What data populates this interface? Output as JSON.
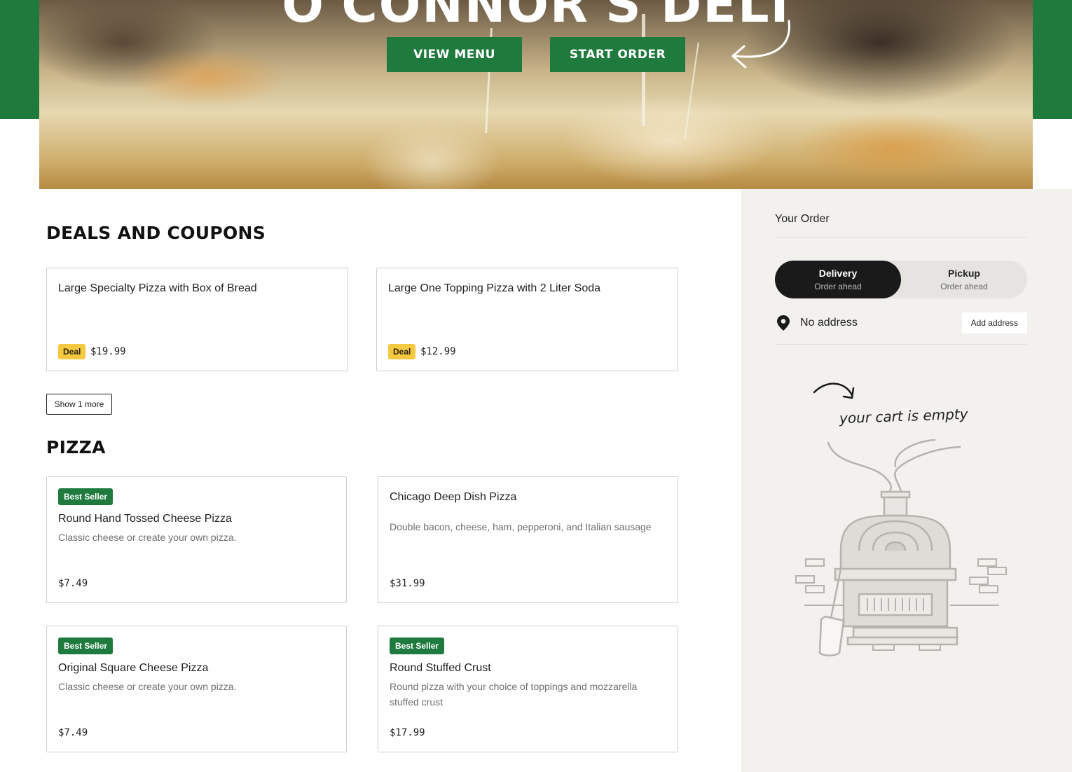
{
  "hero": {
    "title": "O'CONNOR'S DELI",
    "view_menu": "VIEW MENU",
    "start_order": "START ORDER"
  },
  "deals": {
    "title": "DEALS AND COUPONS",
    "items": [
      {
        "name": "Large Specialty Pizza with Box of Bread",
        "badge": "Deal",
        "price": "$19.99"
      },
      {
        "name": "Large One Topping Pizza with 2 Liter Soda",
        "badge": "Deal",
        "price": "$12.99"
      }
    ],
    "show_more": "Show 1 more"
  },
  "pizza": {
    "title": "PIZZA",
    "items": [
      {
        "badge": "Best Seller",
        "name": "Round Hand Tossed Cheese Pizza",
        "desc": "Classic cheese or create your own pizza.",
        "price": "$7.49"
      },
      {
        "badge": "",
        "name": "Chicago Deep Dish Pizza",
        "desc": "Double bacon, cheese, ham, pepperoni, and Italian sausage",
        "price": "$31.99"
      },
      {
        "badge": "Best Seller",
        "name": "Original Square Cheese Pizza",
        "desc": "Classic cheese or create your own pizza.",
        "price": "$7.49"
      },
      {
        "badge": "Best Seller",
        "name": "Round Stuffed Crust",
        "desc": "Round pizza with your choice of toppings and mozzarella stuffed crust",
        "price": "$17.99"
      }
    ]
  },
  "order": {
    "title": "Your Order",
    "delivery": {
      "label": "Delivery",
      "sub": "Order ahead"
    },
    "pickup": {
      "label": "Pickup",
      "sub": "Order ahead"
    },
    "no_address": "No address",
    "add_address": "Add address",
    "empty_text": "your cart is empty"
  },
  "colors": {
    "brand_green": "#1f7a3e",
    "deal_yellow": "#f5c842",
    "sidebar_bg": "#f2f1ee"
  }
}
